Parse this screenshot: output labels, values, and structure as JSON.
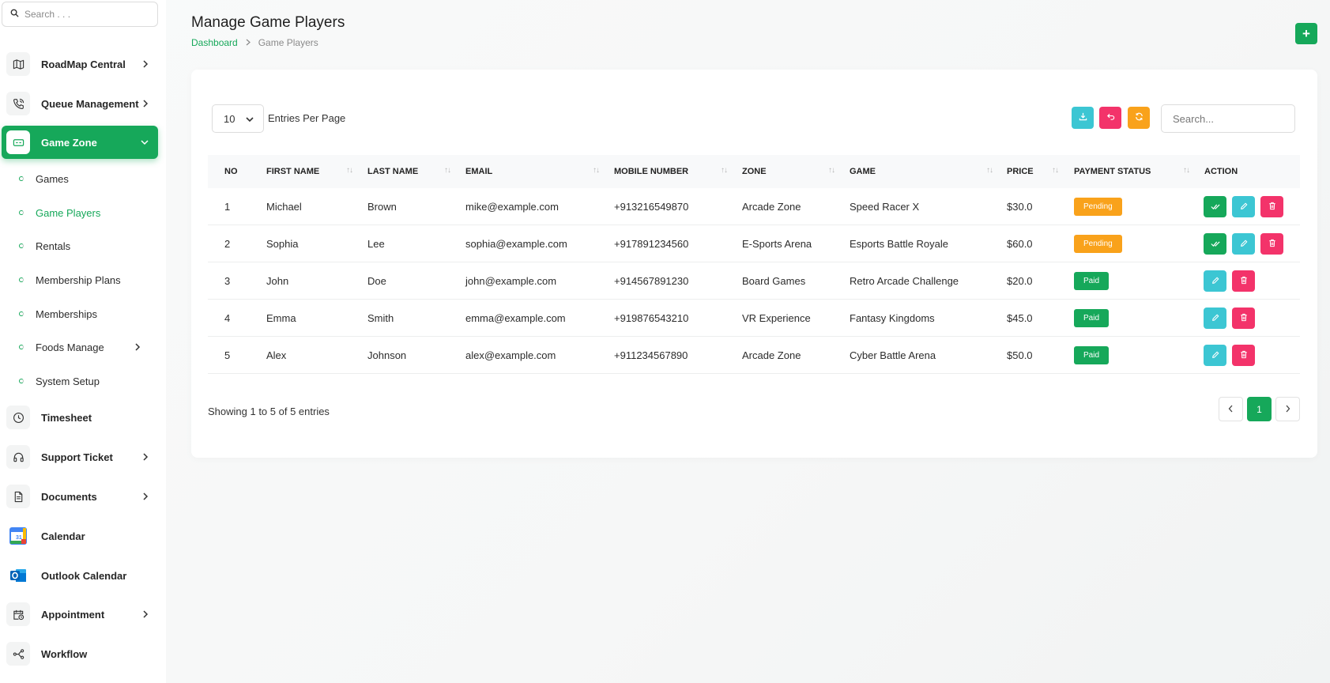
{
  "sidebar": {
    "search_placeholder": "Search . . .",
    "items": [
      {
        "label": "RoadMap Central",
        "icon": "map-icon",
        "chevron": true
      },
      {
        "label": "Queue Management",
        "icon": "phone-icon",
        "chevron": true
      },
      {
        "label": "Game Zone",
        "icon": "ticket-icon",
        "chevron": true,
        "active": true
      },
      {
        "label": "Timesheet",
        "icon": "clock-icon",
        "chevron": false
      },
      {
        "label": "Support Ticket",
        "icon": "headset-icon",
        "chevron": true
      },
      {
        "label": "Documents",
        "icon": "document-icon",
        "chevron": true
      },
      {
        "label": "Calendar",
        "icon": "google-calendar-icon",
        "chevron": false
      },
      {
        "label": "Outlook Calendar",
        "icon": "outlook-icon",
        "chevron": false
      },
      {
        "label": "Appointment",
        "icon": "calendar-clock-icon",
        "chevron": true
      },
      {
        "label": "Workflow",
        "icon": "workflow-icon",
        "chevron": false
      }
    ],
    "sub_items": [
      {
        "label": "Games"
      },
      {
        "label": "Game Players",
        "active": true
      },
      {
        "label": "Rentals"
      },
      {
        "label": "Membership Plans"
      },
      {
        "label": "Memberships"
      },
      {
        "label": "Foods Manage",
        "chevron": true
      },
      {
        "label": "System Setup"
      }
    ]
  },
  "header": {
    "title": "Manage Game Players",
    "breadcrumb": {
      "home": "Dashboard",
      "current": "Game Players"
    },
    "add_label": "+"
  },
  "toolbar": {
    "entries_value": "10",
    "entries_label": "Entries Per Page",
    "search_placeholder": "Search..."
  },
  "table": {
    "columns": [
      "NO",
      "FIRST NAME",
      "LAST NAME",
      "EMAIL",
      "MOBILE NUMBER",
      "ZONE",
      "GAME",
      "PRICE",
      "PAYMENT STATUS",
      "ACTION"
    ],
    "rows": [
      {
        "no": "1",
        "first": "Michael",
        "last": "Brown",
        "email": "mike@example.com",
        "mobile": "+913216549870",
        "zone": "Arcade Zone",
        "game": "Speed Racer X",
        "price": "$30.0",
        "status": "Pending"
      },
      {
        "no": "2",
        "first": "Sophia",
        "last": "Lee",
        "email": "sophia@example.com",
        "mobile": "+917891234560",
        "zone": "E-Sports Arena",
        "game": "Esports Battle Royale",
        "price": "$60.0",
        "status": "Pending"
      },
      {
        "no": "3",
        "first": "John",
        "last": "Doe",
        "email": "john@example.com",
        "mobile": "+914567891230",
        "zone": "Board Games",
        "game": "Retro Arcade Challenge",
        "price": "$20.0",
        "status": "Paid"
      },
      {
        "no": "4",
        "first": "Emma",
        "last": "Smith",
        "email": "emma@example.com",
        "mobile": "+919876543210",
        "zone": "VR Experience",
        "game": "Fantasy Kingdoms",
        "price": "$45.0",
        "status": "Paid"
      },
      {
        "no": "5",
        "first": "Alex",
        "last": "Johnson",
        "email": "alex@example.com",
        "mobile": "+911234567890",
        "zone": "Arcade Zone",
        "game": "Cyber Battle Arena",
        "price": "$50.0",
        "status": "Paid"
      }
    ]
  },
  "footer": {
    "showing": "Showing 1 to 5 of 5 entries",
    "current_page": "1"
  },
  "colors": {
    "primary": "#16a85a",
    "pending": "#f9a21b",
    "edit": "#3cc6d3",
    "delete": "#f3336a"
  }
}
